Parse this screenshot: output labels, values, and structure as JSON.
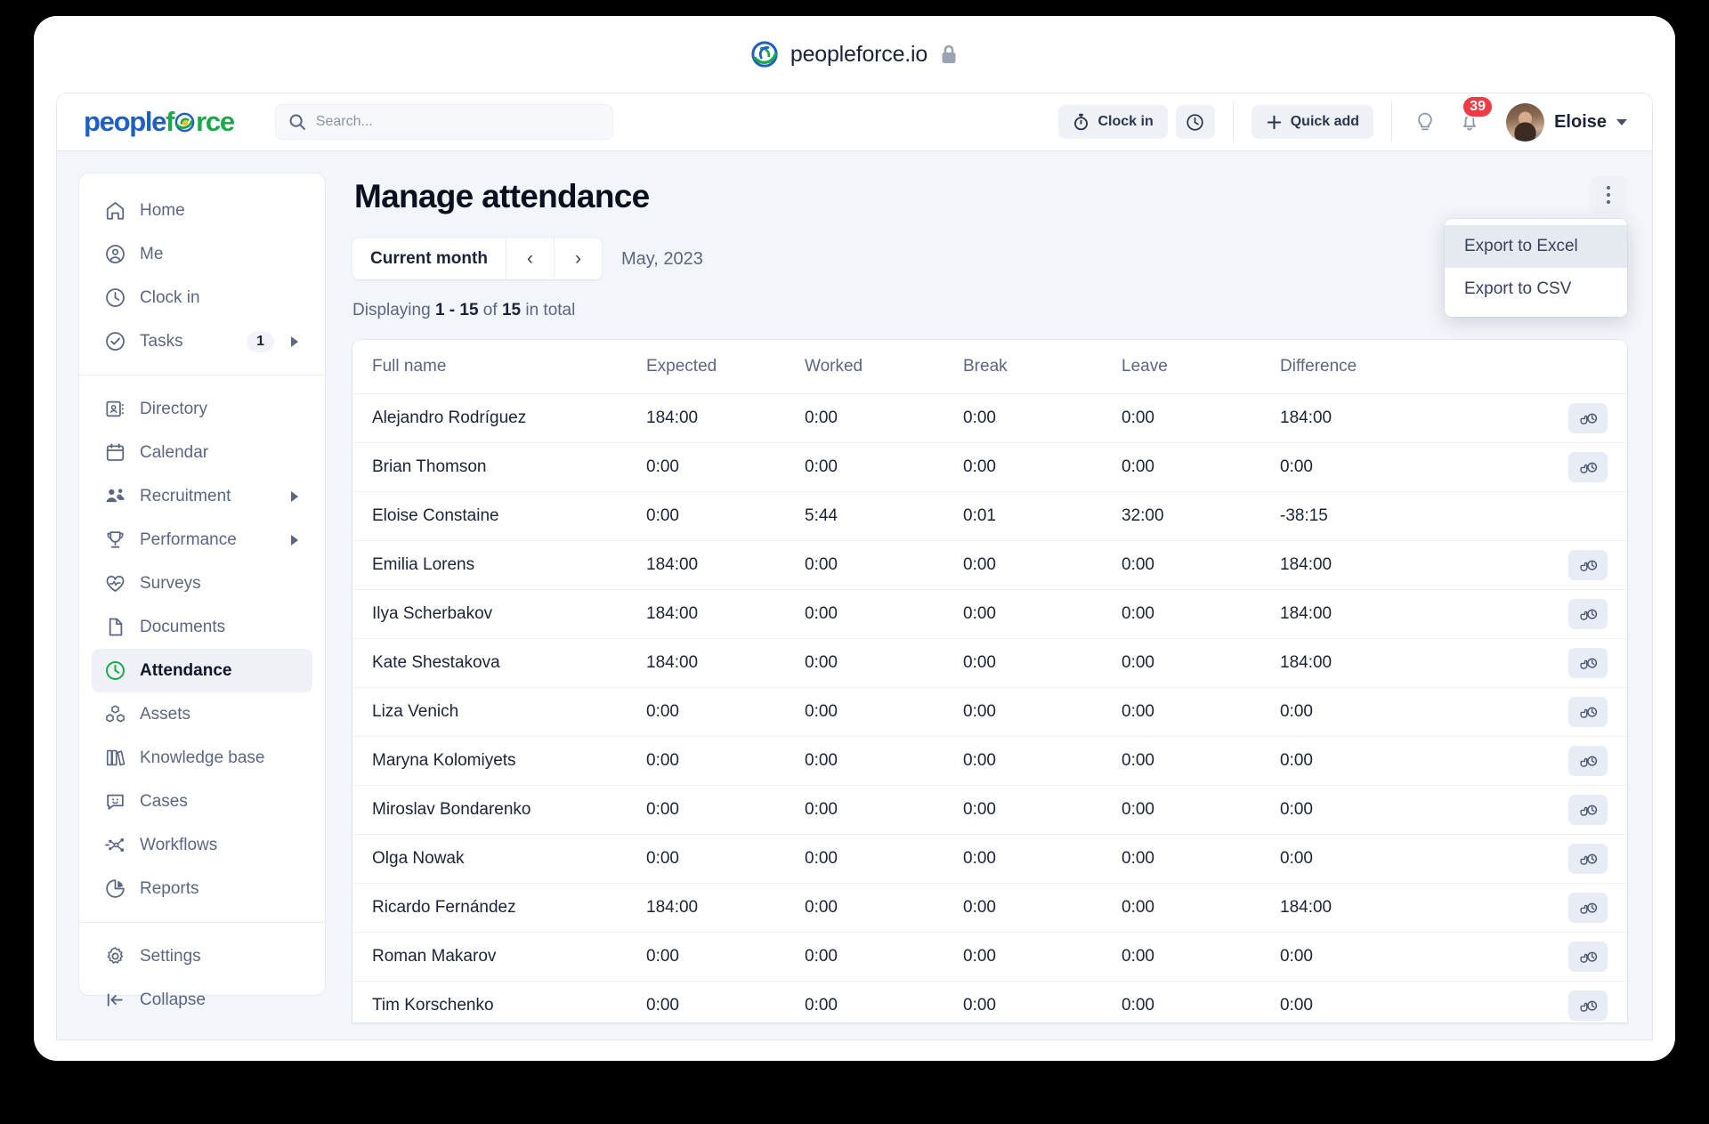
{
  "browser": {
    "title": "peopleforce.io",
    "favicon_name": "peopleforce-favicon",
    "lock_name": "lock-icon"
  },
  "topnav": {
    "logo": {
      "part1": "people",
      "part2": "f",
      "part3": "rce"
    },
    "search": {
      "value": "",
      "placeholder": "Search..."
    },
    "clock_in_label": "Clock in",
    "quick_add_label": "Quick add",
    "notifications_badge": "39",
    "user_name": "Eloise"
  },
  "sidebar": {
    "groups": [
      {
        "items": [
          {
            "label": "Home",
            "icon": "home-icon",
            "count": "",
            "submenu": false
          },
          {
            "label": "Me",
            "icon": "user-icon",
            "count": "",
            "submenu": false
          },
          {
            "label": "Clock in",
            "icon": "clock-icon",
            "count": "",
            "submenu": false
          },
          {
            "label": "Tasks",
            "icon": "check-circle-icon",
            "count": "1",
            "submenu": true
          }
        ]
      },
      {
        "items": [
          {
            "label": "Directory",
            "icon": "contact-card-icon",
            "count": "",
            "submenu": false
          },
          {
            "label": "Calendar",
            "icon": "calendar-icon",
            "count": "",
            "submenu": false
          },
          {
            "label": "Recruitment",
            "icon": "people-icon",
            "count": "",
            "submenu": true
          },
          {
            "label": "Performance",
            "icon": "trophy-icon",
            "count": "",
            "submenu": true
          },
          {
            "label": "Surveys",
            "icon": "heart-pulse-icon",
            "count": "",
            "submenu": false
          },
          {
            "label": "Documents",
            "icon": "document-icon",
            "count": "",
            "submenu": false
          },
          {
            "label": "Attendance",
            "icon": "clock-green-icon",
            "count": "",
            "submenu": false,
            "active": true
          },
          {
            "label": "Assets",
            "icon": "boxes-icon",
            "count": "",
            "submenu": false
          },
          {
            "label": "Knowledge base",
            "icon": "books-icon",
            "count": "",
            "submenu": false
          },
          {
            "label": "Cases",
            "icon": "chat-smile-icon",
            "count": "",
            "submenu": false
          },
          {
            "label": "Workflows",
            "icon": "workflow-icon",
            "count": "",
            "submenu": false
          },
          {
            "label": "Reports",
            "icon": "pie-chart-icon",
            "count": "",
            "submenu": false
          }
        ]
      },
      {
        "items": [
          {
            "label": "Settings",
            "icon": "gear-icon",
            "count": "",
            "submenu": false
          },
          {
            "label": "Collapse",
            "icon": "collapse-left-icon",
            "count": "",
            "submenu": false
          }
        ]
      }
    ]
  },
  "main": {
    "page_title": "Manage attendance",
    "toolbar": {
      "current_month_label": "Current month",
      "prev_label": "‹",
      "next_label": "›",
      "month_label": "May, 2023"
    },
    "displaying": {
      "prefix": "Displaying ",
      "range": "1 - 15",
      "middle": " of ",
      "total": "15",
      "suffix": " in total"
    },
    "dropdown": {
      "items": [
        {
          "label": "Export to Excel",
          "highlight": true
        },
        {
          "label": "Export to CSV",
          "highlight": false
        }
      ]
    },
    "table": {
      "columns": [
        "Full name",
        "Expected",
        "Worked",
        "Break",
        "Leave",
        "Difference"
      ],
      "row_action_icon": "clock-in-hand-icon",
      "rows": [
        {
          "name": "Alejandro Rodríguez",
          "expected": "184:00",
          "worked": "0:00",
          "break": "0:00",
          "leave": "0:00",
          "difference": "184:00",
          "action": true
        },
        {
          "name": "Brian Thomson",
          "expected": "0:00",
          "worked": "0:00",
          "break": "0:00",
          "leave": "0:00",
          "difference": "0:00",
          "action": true
        },
        {
          "name": "Eloise Constaine",
          "expected": "0:00",
          "worked": "5:44",
          "break": "0:01",
          "leave": "32:00",
          "difference": "-38:15",
          "action": false
        },
        {
          "name": "Emilia Lorens",
          "expected": "184:00",
          "worked": "0:00",
          "break": "0:00",
          "leave": "0:00",
          "difference": "184:00",
          "action": true
        },
        {
          "name": "Ilya Scherbakov",
          "expected": "184:00",
          "worked": "0:00",
          "break": "0:00",
          "leave": "0:00",
          "difference": "184:00",
          "action": true
        },
        {
          "name": "Kate Shestakova",
          "expected": "184:00",
          "worked": "0:00",
          "break": "0:00",
          "leave": "0:00",
          "difference": "184:00",
          "action": true
        },
        {
          "name": "Liza Venich",
          "expected": "0:00",
          "worked": "0:00",
          "break": "0:00",
          "leave": "0:00",
          "difference": "0:00",
          "action": true
        },
        {
          "name": "Maryna Kolomiyets",
          "expected": "0:00",
          "worked": "0:00",
          "break": "0:00",
          "leave": "0:00",
          "difference": "0:00",
          "action": true
        },
        {
          "name": "Miroslav Bondarenko",
          "expected": "0:00",
          "worked": "0:00",
          "break": "0:00",
          "leave": "0:00",
          "difference": "0:00",
          "action": true
        },
        {
          "name": "Olga Nowak",
          "expected": "0:00",
          "worked": "0:00",
          "break": "0:00",
          "leave": "0:00",
          "difference": "0:00",
          "action": true
        },
        {
          "name": "Ricardo Fernández",
          "expected": "184:00",
          "worked": "0:00",
          "break": "0:00",
          "leave": "0:00",
          "difference": "184:00",
          "action": true
        },
        {
          "name": "Roman Makarov",
          "expected": "0:00",
          "worked": "0:00",
          "break": "0:00",
          "leave": "0:00",
          "difference": "0:00",
          "action": true
        },
        {
          "name": "Tim Korschenko",
          "expected": "0:00",
          "worked": "0:00",
          "break": "0:00",
          "leave": "0:00",
          "difference": "0:00",
          "action": true
        },
        {
          "name": "",
          "expected": "",
          "worked": "",
          "break": "",
          "leave": "",
          "difference": "",
          "action": true
        }
      ]
    }
  },
  "colors": {
    "accent_blue": "#1f5fc4",
    "accent_green": "#1aa84a",
    "badge_red": "#ef3b46",
    "page_bg": "#f2f5f9",
    "text_dark": "#1b2337",
    "text_muted": "#5b6680"
  }
}
